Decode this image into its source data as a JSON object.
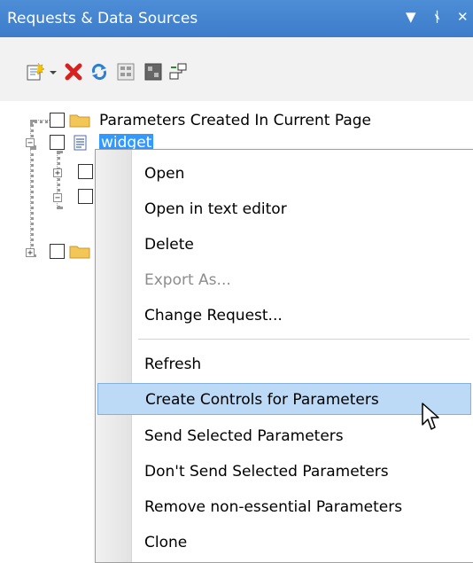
{
  "window": {
    "title": "Requests & Data Sources",
    "controls": [
      "▼",
      "ᛀ",
      "✕"
    ]
  },
  "toolbar": {
    "icons": [
      "new-request-icon",
      "dropdown-icon",
      "delete-icon",
      "refresh-icon",
      "properties-icon",
      "grid-icon",
      "network-icon"
    ]
  },
  "tree": {
    "items": [
      {
        "label": "Parameters Created In Current Page"
      },
      {
        "label": "widget"
      }
    ]
  },
  "context_menu": {
    "items": [
      {
        "label": "Open",
        "enabled": true
      },
      {
        "label": "Open in text editor",
        "enabled": true
      },
      {
        "label": "Delete",
        "enabled": true
      },
      {
        "label": "Export As...",
        "enabled": false
      },
      {
        "label": "Change Request...",
        "enabled": true
      },
      {
        "label": "Refresh",
        "enabled": true
      },
      {
        "label": "Create Controls for Parameters",
        "enabled": true,
        "highlighted": true
      },
      {
        "label": "Send Selected Parameters",
        "enabled": true
      },
      {
        "label": "Don't Send Selected Parameters",
        "enabled": true
      },
      {
        "label": "Remove non-essential Parameters",
        "enabled": true
      },
      {
        "label": "Clone",
        "enabled": true
      }
    ]
  },
  "colors": {
    "titlebar": "#3c7cc9",
    "selection": "#3399ff",
    "menu_hover": "#bcd9f5"
  }
}
